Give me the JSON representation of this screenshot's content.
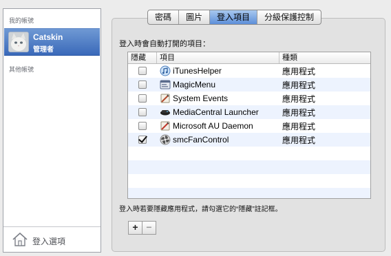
{
  "sidebar": {
    "my_account_header": "我的帳號",
    "account": {
      "name": "Catskin",
      "role": "管理者"
    },
    "other_accounts_header": "其他帳號",
    "login_options_label": "登入選項"
  },
  "tabs": [
    {
      "label": "密碼",
      "active": false
    },
    {
      "label": "圖片",
      "active": false
    },
    {
      "label": "登入項目",
      "active": true
    },
    {
      "label": "分級保護控制",
      "active": false
    }
  ],
  "section_label": "登入時會自動打開的項目：",
  "table": {
    "columns": {
      "hide": "隱藏",
      "item": "項目",
      "kind": "種類"
    },
    "rows": [
      {
        "hide": false,
        "name": "iTunesHelper",
        "kind": "應用程式",
        "icon": "itunes-helper-icon"
      },
      {
        "hide": false,
        "name": "MagicMenu",
        "kind": "應用程式",
        "icon": "magic-menu-icon"
      },
      {
        "hide": false,
        "name": "System Events",
        "kind": "應用程式",
        "icon": "system-events-icon"
      },
      {
        "hide": false,
        "name": "MediaCentral Launcher",
        "kind": "應用程式",
        "icon": "mediacentral-icon"
      },
      {
        "hide": false,
        "name": "Microsoft AU Daemon",
        "kind": "應用程式",
        "icon": "microsoft-au-icon"
      },
      {
        "hide": true,
        "name": "smcFanControl",
        "kind": "應用程式",
        "icon": "fan-control-icon"
      }
    ]
  },
  "hint": "登入時若要隱藏應用程式，請勾選它的“隱藏”註記框。",
  "buttons": {
    "add": "+",
    "remove": "−"
  },
  "colors": {
    "selection": "#3a69b9",
    "alt_row": "#edf3fe",
    "active_tab": "#5d8fd9"
  }
}
